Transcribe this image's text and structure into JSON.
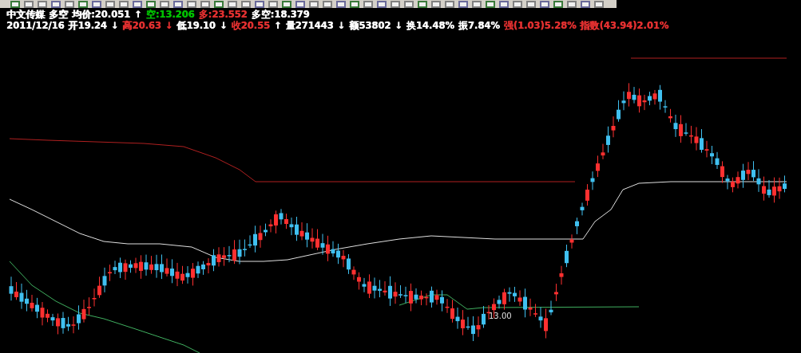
{
  "quote_line": [
    {
      "text": "中文传媒",
      "color": "#ffffff"
    },
    {
      "text": "多空",
      "color": "#ffffff"
    },
    {
      "text": "均价:20.051",
      "color": "#ffffff"
    },
    {
      "text": "↑",
      "color": "#ffffff"
    },
    {
      "text": "空:13.206",
      "color": "#00c000"
    },
    {
      "text": "多:23.552",
      "color": "#e03030"
    },
    {
      "text": "多空:18.379",
      "color": "#ffffff"
    }
  ],
  "detail_line": [
    {
      "text": "2011/12/16",
      "color": "#ffffff"
    },
    {
      "text": "开19.24",
      "color": "#ffffff"
    },
    {
      "text": "↓",
      "color": "#ffffff"
    },
    {
      "text": "高20.63",
      "color": "#e03030"
    },
    {
      "text": "↓",
      "color": "#e03030"
    },
    {
      "text": "低19.10",
      "color": "#ffffff"
    },
    {
      "text": "↓",
      "color": "#ffffff"
    },
    {
      "text": "收20.55",
      "color": "#e03030"
    },
    {
      "text": "↑",
      "color": "#ffffff"
    },
    {
      "text": "量271443",
      "color": "#ffffff"
    },
    {
      "text": "↓",
      "color": "#ffffff"
    },
    {
      "text": "额53802",
      "color": "#ffffff"
    },
    {
      "text": "↓",
      "color": "#ffffff"
    },
    {
      "text": "换14.48%",
      "color": "#ffffff"
    },
    {
      "text": "振7.84%",
      "color": "#ffffff"
    },
    {
      "text": "强(1.03)5.28%",
      "color": "#e03030"
    },
    {
      "text": "指数(43.94)2.01%",
      "color": "#e03030"
    }
  ],
  "chart": {
    "low_label": "13.00"
  }
}
